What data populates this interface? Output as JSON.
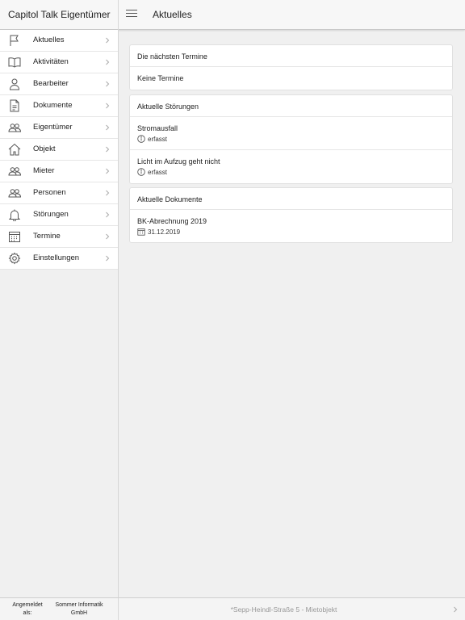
{
  "app": {
    "title": "Capitol Talk Eigentümer"
  },
  "header": {
    "page_title": "Aktuelles"
  },
  "sidebar": {
    "items": [
      {
        "label": "Aktuelles",
        "icon": "flag-icon"
      },
      {
        "label": "Aktivitäten",
        "icon": "book-icon"
      },
      {
        "label": "Bearbeiter",
        "icon": "person-icon"
      },
      {
        "label": "Dokumente",
        "icon": "document-icon"
      },
      {
        "label": "Eigentümer",
        "icon": "people-icon"
      },
      {
        "label": "Objekt",
        "icon": "house-icon"
      },
      {
        "label": "Mieter",
        "icon": "people-icon"
      },
      {
        "label": "Personen",
        "icon": "people-icon"
      },
      {
        "label": "Störungen",
        "icon": "bell-icon"
      },
      {
        "label": "Termine",
        "icon": "calendar-icon"
      },
      {
        "label": "Einstellungen",
        "icon": "gear-icon"
      }
    ]
  },
  "main": {
    "appointments": {
      "header": "Die nächsten Termine",
      "empty_text": "Keine Termine"
    },
    "disruptions": {
      "header": "Aktuelle Störungen",
      "items": [
        {
          "title": "Stromausfall",
          "status": "erfasst"
        },
        {
          "title": "Licht im Aufzug geht nicht",
          "status": "erfasst"
        }
      ]
    },
    "documents": {
      "header": "Aktuelle Dokumente",
      "items": [
        {
          "title": "BK-Abrechnung 2019",
          "date": "31.12.2019"
        }
      ]
    }
  },
  "footer": {
    "logged_in_label": "Angemeldet als:",
    "company": "Sommer Informatik GmbH",
    "object": "*Sepp-Heindl-Straße 5 - Mietobjekt"
  },
  "colors": {
    "background": "#f0f0f0",
    "card": "#ffffff",
    "muted_text": "#999999",
    "icon_stroke": "#555555"
  }
}
